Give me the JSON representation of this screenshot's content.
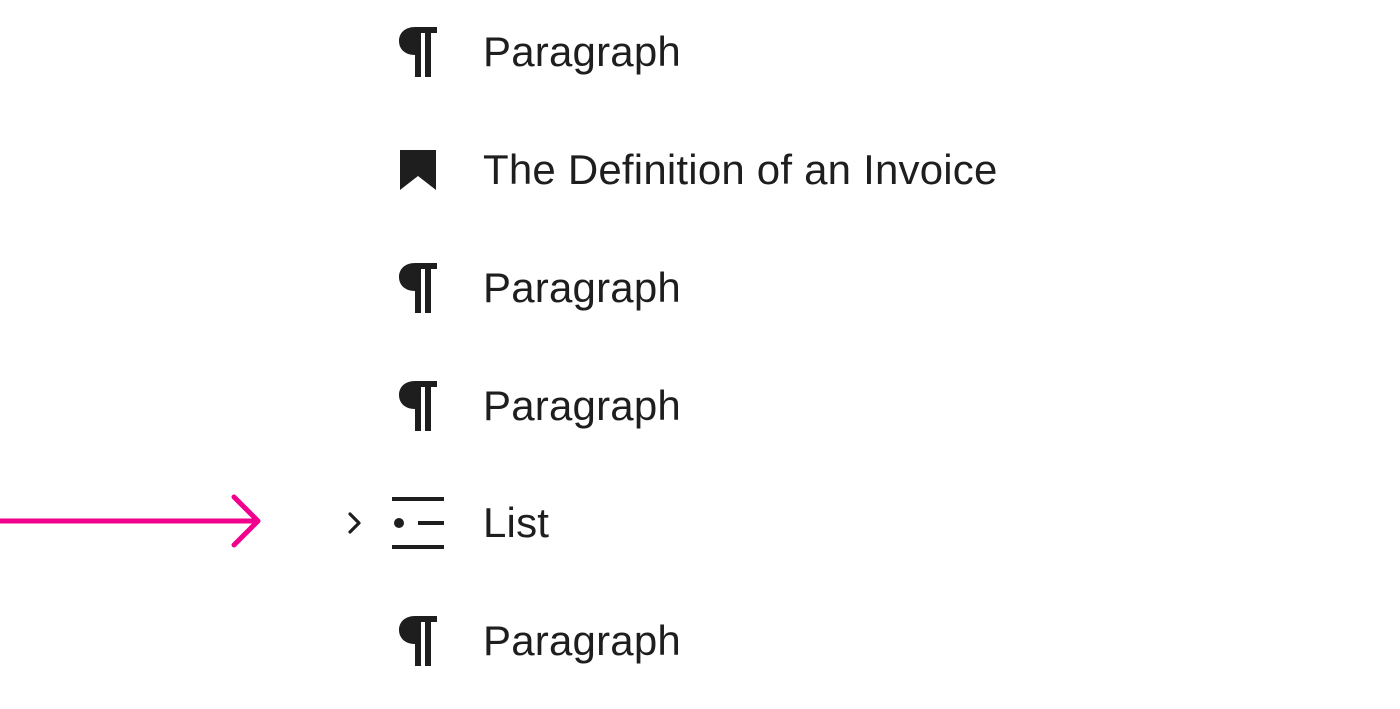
{
  "list_view": {
    "items": [
      {
        "label": "Paragraph",
        "icon": "paragraph-icon",
        "expandable": false
      },
      {
        "label": "The Definition of an Invoice",
        "icon": "bookmark-icon",
        "expandable": false
      },
      {
        "label": "Paragraph",
        "icon": "paragraph-icon",
        "expandable": false
      },
      {
        "label": "Paragraph",
        "icon": "paragraph-icon",
        "expandable": false
      },
      {
        "label": "List",
        "icon": "list-icon",
        "expandable": true,
        "expander_icon": "chevron-right-icon"
      },
      {
        "label": "Paragraph",
        "icon": "paragraph-icon",
        "expandable": false
      }
    ]
  },
  "annotation": {
    "icon": "arrow-right-icon",
    "color": "#f0008c"
  },
  "colors": {
    "text": "#1e1e1e",
    "background": "#ffffff"
  }
}
